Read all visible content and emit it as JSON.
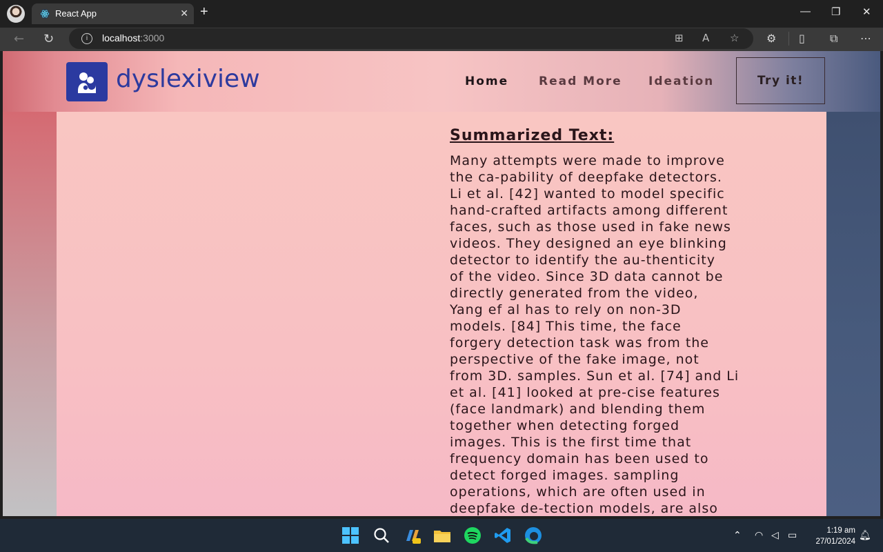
{
  "browser": {
    "tab_title": "React App",
    "url_host": "localhost",
    "url_port": ":3000",
    "icons": [
      "profile-avatar",
      "react-favicon",
      "close-icon",
      "new-tab-icon",
      "minimize-icon",
      "maximize-icon",
      "close-window-icon",
      "back-icon",
      "refresh-icon",
      "info-icon",
      "app-icon",
      "read-aloud-icon",
      "favorite-star-icon",
      "extensions-icon",
      "split-screen-icon",
      "collections-icon",
      "more-icon"
    ]
  },
  "app": {
    "brand": "dyslexiview",
    "brand_color": "#2d3a9e",
    "nav": [
      {
        "label": "Home",
        "color": "#1e1418"
      },
      {
        "label": "Read More",
        "color": "#5a3a40"
      },
      {
        "label": "Ideation",
        "color": "#5a3a40"
      }
    ],
    "cta_label": "Try it!",
    "summary_heading": "Summarized Text:",
    "summary_text": "Many attempts were made to improve\nthe ca-pability of deepfake detectors.\nLi et al. [42] wanted to model specific\nhand-crafted artifacts among different\nfaces, such as those used in fake news\nvideos. They designed an eye blinking\ndetector to identify the au-thenticity\nof the video. Since 3D data cannot be\ndirectly generated from the video,\nYang ef al has to rely on non-3D\nmodels. [84] This time, the face\nforgery detection task was from the\nperspective of the fake image, not\nfrom 3D. samples. Sun et al. [74] and Li\net al. [41] looked at pre-cise features\n(face landmark) and blending them\ntogether when detecting forged\nimages. This is the first time that\nfrequency domain has been used to\ndetect forged images. sampling\noperations, which are often used in\ndeepfake de-tection models, are also"
  },
  "taskbar": {
    "time": "1:19 am",
    "date": "27/01/2024",
    "apps": [
      "windows-start-icon",
      "search-icon",
      "copilot-pre-icon",
      "file-explorer-icon",
      "spotify-icon",
      "vscode-icon",
      "edge-icon"
    ]
  }
}
